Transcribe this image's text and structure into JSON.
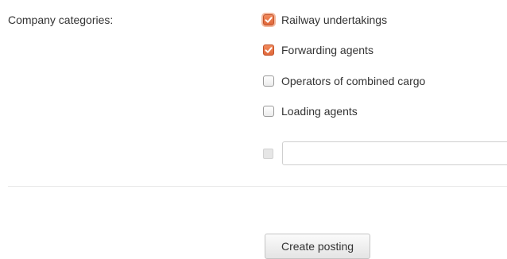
{
  "form": {
    "field_label": "Company categories:",
    "options": [
      {
        "label": "Railway undertakings",
        "checked": true,
        "focused": true
      },
      {
        "label": "Forwarding agents",
        "checked": true,
        "focused": false
      },
      {
        "label": "Operators of combined cargo",
        "checked": false,
        "focused": false
      },
      {
        "label": "Loading agents",
        "checked": false,
        "focused": false
      }
    ],
    "other": {
      "checked": false,
      "disabled": true,
      "input_value": "",
      "input_placeholder": ""
    },
    "submit_label": "Create posting"
  },
  "colors": {
    "checkbox_checked": "#e8764a",
    "checkbox_focus_ring": "#f4b89d",
    "divider": "#e8e8e8"
  }
}
